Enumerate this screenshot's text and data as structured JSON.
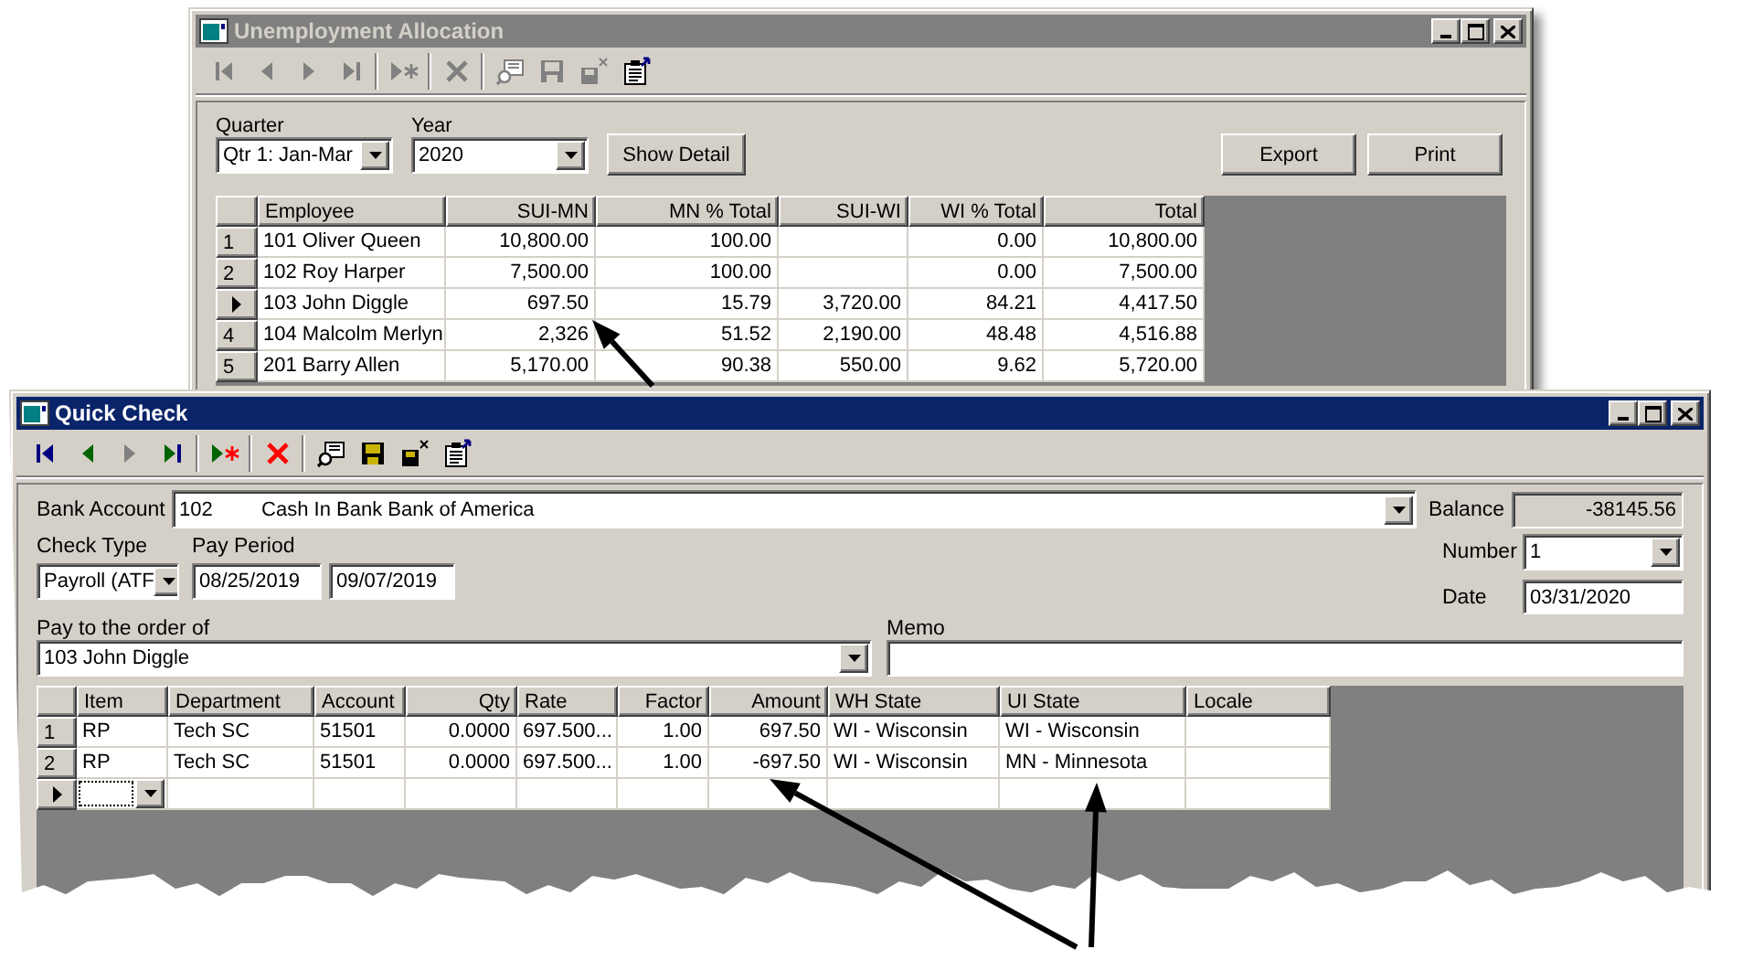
{
  "unemployment_allocation": {
    "title": "Unemployment Allocation",
    "active": false,
    "toolbar": [
      {
        "kind": "first",
        "disabled": true
      },
      {
        "kind": "prev",
        "disabled": true
      },
      {
        "kind": "next",
        "disabled": true
      },
      {
        "kind": "last",
        "disabled": true
      },
      {
        "kind": "new",
        "disabled": true
      },
      {
        "kind": "delete",
        "disabled": true
      },
      {
        "kind": "find",
        "disabled": true
      },
      {
        "kind": "save",
        "disabled": true
      },
      {
        "kind": "save-close",
        "disabled": true
      },
      {
        "kind": "properties",
        "disabled": false
      }
    ],
    "quarter": {
      "label": "Quarter",
      "value": "Qtr 1: Jan-Mar"
    },
    "year": {
      "label": "Year",
      "value": "2020"
    },
    "buttons": [
      {
        "kind": "detail",
        "label": "Show Detail"
      },
      {
        "kind": "export",
        "label": "Export"
      },
      {
        "kind": "print",
        "label": "Print"
      }
    ],
    "table": {
      "columns": [
        "Employee",
        "SUI-MN",
        "MN % Total",
        "SUI-WI",
        "WI % Total",
        "Total"
      ],
      "rows": [
        {
          "number": "1",
          "current": false,
          "cells": [
            "101 Oliver Queen",
            "10,800.00",
            "100.00",
            null,
            "0.00",
            "10,800.00"
          ]
        },
        {
          "number": "2",
          "current": false,
          "cells": [
            "102 Roy Harper",
            "7,500.00",
            "100.00",
            null,
            "0.00",
            "7,500.00"
          ]
        },
        {
          "current": true,
          "cells": [
            "103 John Diggle",
            "697.50",
            "15.79",
            "3,720.00",
            "84.21",
            "4,417.50"
          ]
        },
        {
          "number": "4",
          "current": false,
          "cells": [
            "104 Malcolm Merlyn",
            "2,326",
            "51.52",
            "2,190.00",
            "48.48",
            "4,516.88"
          ]
        },
        {
          "number": "5",
          "current": false,
          "cells": [
            "201 Barry Allen",
            "5,170.00",
            "90.38",
            "550.00",
            "9.62",
            "5,720.00"
          ]
        }
      ]
    }
  },
  "quick_check": {
    "title": "Quick Check",
    "active": true,
    "toolbar": [
      {
        "kind": "first",
        "disabled": false
      },
      {
        "kind": "prev",
        "disabled": false
      },
      {
        "kind": "next",
        "disabled": true
      },
      {
        "kind": "last",
        "disabled": false
      },
      {
        "kind": "new",
        "disabled": false
      },
      {
        "kind": "delete",
        "disabled": false
      },
      {
        "kind": "find",
        "disabled": false
      },
      {
        "kind": "save",
        "disabled": false
      },
      {
        "kind": "save-close",
        "disabled": false
      },
      {
        "kind": "properties",
        "disabled": false
      }
    ],
    "bank_account": {
      "label": "Bank Account",
      "number": "102",
      "name": "Cash In Bank Bank of America"
    },
    "balance": {
      "label": "Balance",
      "value": "-38145.56"
    },
    "check_type": {
      "label": "Check Type",
      "value": "Payroll (ATF"
    },
    "pay_period": {
      "label": "Pay Period",
      "start": "08/25/2019",
      "end": "09/07/2019"
    },
    "number": {
      "label": "Number",
      "value": "1"
    },
    "date": {
      "label": "Date",
      "value": "03/31/2020"
    },
    "pay_to": {
      "label": "Pay to the order of",
      "value": "103 John Diggle"
    },
    "memo": {
      "label": "Memo"
    },
    "table": {
      "columns": [
        "Item",
        "Department",
        "Account",
        "Qty",
        "Rate",
        "Factor",
        "Amount",
        "WH State",
        "UI State",
        "Locale"
      ],
      "rows": [
        {
          "number": "1",
          "current": false,
          "cells": [
            "RP",
            "Tech SC",
            "51501",
            "0.0000",
            "697.500...",
            "1.00",
            "697.50",
            "WI - Wisconsin",
            "WI - Wisconsin",
            null
          ]
        },
        {
          "number": "2",
          "current": false,
          "cells": [
            "RP",
            "Tech SC",
            "51501",
            "0.0000",
            "697.500...",
            "1.00",
            "-697.50",
            "WI - Wisconsin",
            "MN - Minnesota",
            null
          ]
        }
      ],
      "new_row": {
        "current": true
      }
    }
  }
}
